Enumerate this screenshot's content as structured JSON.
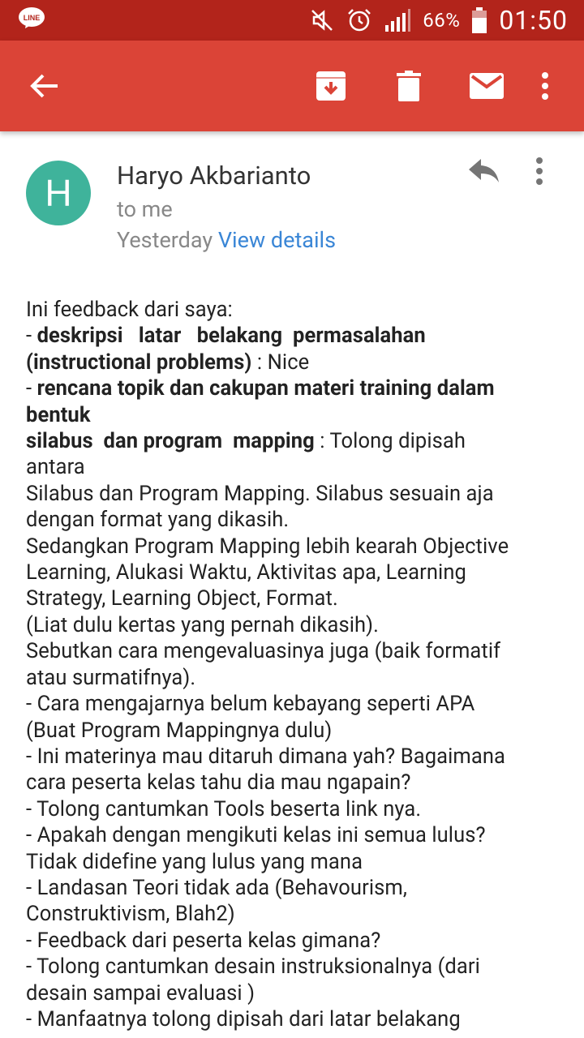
{
  "status_bar": {
    "app_icon": "line-app-icon",
    "battery_percent": "66%",
    "time": "01:50",
    "icons": [
      "mute-icon",
      "alarm-icon",
      "signal-icon",
      "battery-icon"
    ]
  },
  "app_bar": {
    "icons": [
      "back-arrow-icon",
      "archive-icon",
      "trash-icon",
      "mail-icon",
      "more-vert-icon"
    ],
    "color": "#db4437"
  },
  "message": {
    "avatar_letter": "H",
    "avatar_color": "#3fb39b",
    "sender": "Haryo Akbarianto",
    "recipient": "to me",
    "date": "Yesterday",
    "view_details": "View details",
    "lines": [
      {
        "bold": "",
        "text": "Ini feedback dari saya:"
      },
      {
        "bold": "",
        "text": "- "
      },
      {
        "bold": "deskripsi   latar   belakang  permasalahan",
        "text": ""
      },
      {
        "bold": "(instructional problems)",
        "text": " : Nice"
      },
      {
        "bold": "",
        "text": "- "
      },
      {
        "bold": "rencana topik dan cakupan materi training dalam",
        "text": ""
      },
      {
        "bold": "bentuk",
        "text": ""
      },
      {
        "bold": "silabus  dan program  mapping",
        "text": " : Tolong dipisah"
      },
      {
        "bold": "",
        "text": "antara"
      },
      {
        "bold": "",
        "text": "Silabus dan Program Mapping. Silabus sesuain aja"
      },
      {
        "bold": "",
        "text": "dengan format yang dikasih."
      },
      {
        "bold": "",
        "text": "Sedangkan Program Mapping lebih kearah Objective"
      },
      {
        "bold": "",
        "text": "Learning, Alukasi Waktu, Aktivitas apa, Learning"
      },
      {
        "bold": "",
        "text": "Strategy, Learning Object, Format."
      },
      {
        "bold": "",
        "text": "(Liat dulu kertas yang pernah dikasih)."
      },
      {
        "bold": "",
        "text": "Sebutkan cara mengevaluasinya juga (baik formatif"
      },
      {
        "bold": "",
        "text": "atau surmatifnya)."
      },
      {
        "bold": "",
        "text": "- Cara mengajarnya belum kebayang seperti APA"
      },
      {
        "bold": "",
        "text": "(Buat Program Mappingnya dulu)"
      },
      {
        "bold": "",
        "text": "- Ini materinya mau ditaruh dimana yah? Bagaimana"
      },
      {
        "bold": "",
        "text": "cara peserta kelas tahu dia mau ngapain?"
      },
      {
        "bold": "",
        "text": "- Tolong cantumkan Tools beserta link nya."
      },
      {
        "bold": "",
        "text": "- Apakah dengan mengikuti kelas ini semua lulus?"
      },
      {
        "bold": "",
        "text": "Tidak didefine yang lulus yang mana"
      },
      {
        "bold": "",
        "text": "- Landasan Teori tidak ada (Behavourism,"
      },
      {
        "bold": "",
        "text": "Construktivism, Blah2)"
      },
      {
        "bold": "",
        "text": "- Feedback dari peserta kelas gimana?"
      },
      {
        "bold": "",
        "text": "- Tolong cantumkan desain instruksionalnya (dari"
      },
      {
        "bold": "",
        "text": "desain sampai evaluasi )"
      },
      {
        "bold": "",
        "text": "- Manfaatnya tolong dipisah dari latar belakang"
      }
    ]
  }
}
